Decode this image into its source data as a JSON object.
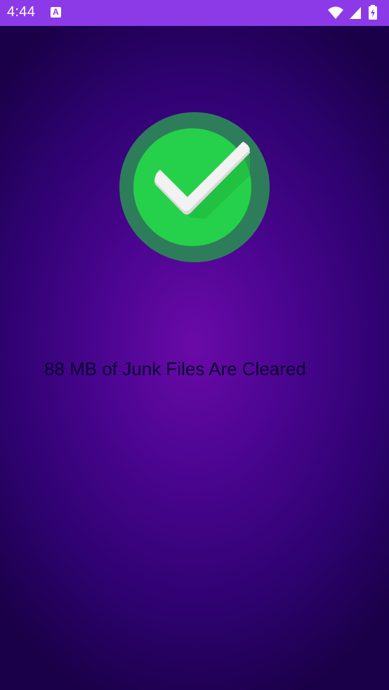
{
  "status_bar": {
    "time": "4:44",
    "app_icon": "accessibility-app-icon",
    "icons": [
      "wifi-icon",
      "cell-signal-icon",
      "battery-charging-icon"
    ],
    "background_color": "#8c3ae8"
  },
  "result": {
    "icon": "check-circle-icon",
    "message": "88 MB of Junk Files Are Cleared",
    "icon_outer_color": "#2e7d5a",
    "icon_inner_color": "#25d14a",
    "check_color": "#f2f2f2"
  },
  "theme": {
    "background_center": "#6a0aa8",
    "background_edge": "#1a0048",
    "text_color": "#0a0030"
  }
}
